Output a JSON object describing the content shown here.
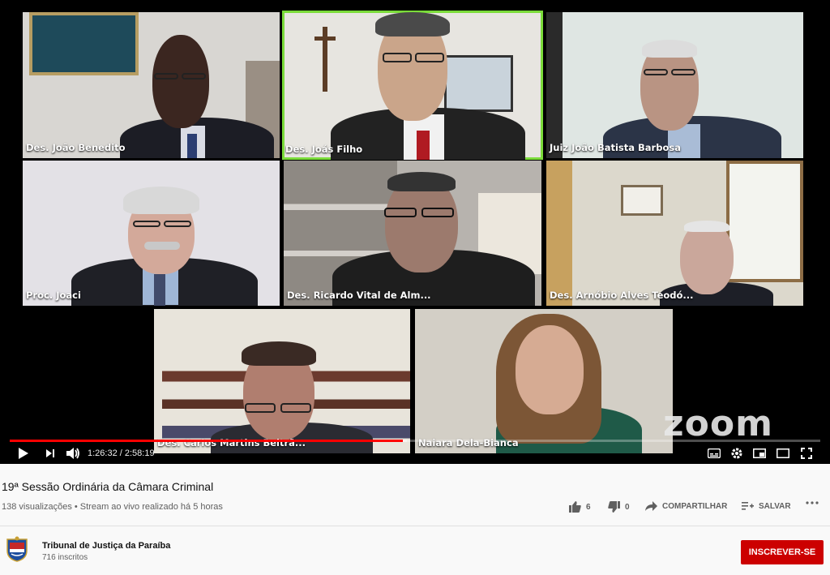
{
  "video": {
    "participants": [
      {
        "name": "Des. João Benedito"
      },
      {
        "name": "Des. Joás Filho"
      },
      {
        "name": "Juiz João Batista Barbosa"
      },
      {
        "name": "Proc. Joaci"
      },
      {
        "name": "Des. Ricardo Vital de Alm..."
      },
      {
        "name": "Des. Arnóbio Alves Teodó..."
      },
      {
        "name": "Des. Carlos Martins Beltrã..."
      },
      {
        "name": "Naiara Dela-Bianca"
      }
    ],
    "active_speaker": "Des. Joás Filho",
    "watermark": "zoom",
    "player": {
      "time_display": "1:26:32 / 2:58:19",
      "played_fraction": 0.485,
      "loaded_fraction": 0.49
    }
  },
  "info": {
    "title": "19ª Sessão Ordinária da Câmara Criminal",
    "meta": "138 visualizações • Stream ao vivo realizado há 5 horas",
    "likes": "6",
    "dislikes": "0",
    "share_label": "COMPARTILHAR",
    "save_label": "SALVAR"
  },
  "channel": {
    "name": "Tribunal de Justiça da Paraíba",
    "subscribers": "716 inscritos",
    "subscribe_label": "INSCREVER-SE"
  },
  "colors": {
    "accent_red": "#cc0000",
    "progress_red": "#ff0000",
    "active_border": "#7bdc3a"
  },
  "icons": [
    "play-icon",
    "next-icon",
    "volume-icon",
    "subtitles-icon",
    "settings-icon",
    "miniplayer-icon",
    "theater-icon",
    "fullscreen-icon",
    "like-icon",
    "dislike-icon",
    "share-icon",
    "save-icon",
    "more-icon"
  ]
}
